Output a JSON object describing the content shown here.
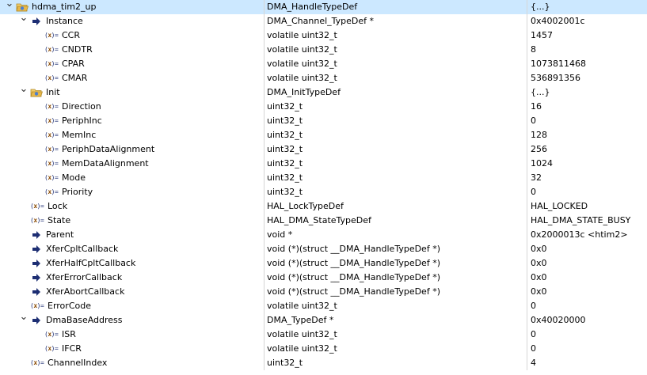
{
  "rows": [
    {
      "id": "r0",
      "name": "hdma_tim2_up",
      "type": "DMA_HandleTypeDef",
      "value": "{...}",
      "icon": "struct-open-folder-icon",
      "depth": 0,
      "toggle": "expanded",
      "selected": true
    },
    {
      "id": "r1",
      "name": "Instance",
      "type": "DMA_Channel_TypeDef *",
      "value": "0x4002001c",
      "icon": "pointer-arrow-icon",
      "depth": 1,
      "toggle": "expanded"
    },
    {
      "id": "r2",
      "name": "CCR",
      "type": "volatile uint32_t",
      "value": "1457",
      "icon": "variable-icon",
      "depth": 2
    },
    {
      "id": "r3",
      "name": "CNDTR",
      "type": "volatile uint32_t",
      "value": "8",
      "icon": "variable-icon",
      "depth": 2
    },
    {
      "id": "r4",
      "name": "CPAR",
      "type": "volatile uint32_t",
      "value": "1073811468",
      "icon": "variable-icon",
      "depth": 2
    },
    {
      "id": "r5",
      "name": "CMAR",
      "type": "volatile uint32_t",
      "value": "536891356",
      "icon": "variable-icon",
      "depth": 2
    },
    {
      "id": "r6",
      "name": "Init",
      "type": "DMA_InitTypeDef",
      "value": "{...}",
      "icon": "struct-open-folder-icon",
      "depth": 1,
      "toggle": "expanded"
    },
    {
      "id": "r7",
      "name": "Direction",
      "type": "uint32_t",
      "value": "16",
      "icon": "variable-icon",
      "depth": 2
    },
    {
      "id": "r8",
      "name": "PeriphInc",
      "type": "uint32_t",
      "value": "0",
      "icon": "variable-icon",
      "depth": 2
    },
    {
      "id": "r9",
      "name": "MemInc",
      "type": "uint32_t",
      "value": "128",
      "icon": "variable-icon",
      "depth": 2
    },
    {
      "id": "r10",
      "name": "PeriphDataAlignment",
      "type": "uint32_t",
      "value": "256",
      "icon": "variable-icon",
      "depth": 2
    },
    {
      "id": "r11",
      "name": "MemDataAlignment",
      "type": "uint32_t",
      "value": "1024",
      "icon": "variable-icon",
      "depth": 2
    },
    {
      "id": "r12",
      "name": "Mode",
      "type": "uint32_t",
      "value": "32",
      "icon": "variable-icon",
      "depth": 2
    },
    {
      "id": "r13",
      "name": "Priority",
      "type": "uint32_t",
      "value": "0",
      "icon": "variable-icon",
      "depth": 2
    },
    {
      "id": "r14",
      "name": "Lock",
      "type": "HAL_LockTypeDef",
      "value": "HAL_LOCKED",
      "icon": "variable-icon",
      "depth": 1
    },
    {
      "id": "r15",
      "name": "State",
      "type": "HAL_DMA_StateTypeDef",
      "value": "HAL_DMA_STATE_BUSY",
      "icon": "variable-icon",
      "depth": 1
    },
    {
      "id": "r16",
      "name": "Parent",
      "type": "void *",
      "value": "0x2000013c <htim2>",
      "icon": "pointer-arrow-icon",
      "depth": 1
    },
    {
      "id": "r17",
      "name": "XferCpltCallback",
      "type": "void (*)(struct __DMA_HandleTypeDef *)",
      "value": "0x0",
      "icon": "pointer-arrow-icon",
      "depth": 1
    },
    {
      "id": "r18",
      "name": "XferHalfCpltCallback",
      "type": "void (*)(struct __DMA_HandleTypeDef *)",
      "value": "0x0",
      "icon": "pointer-arrow-icon",
      "depth": 1
    },
    {
      "id": "r19",
      "name": "XferErrorCallback",
      "type": "void (*)(struct __DMA_HandleTypeDef *)",
      "value": "0x0",
      "icon": "pointer-arrow-icon",
      "depth": 1
    },
    {
      "id": "r20",
      "name": "XferAbortCallback",
      "type": "void (*)(struct __DMA_HandleTypeDef *)",
      "value": "0x0",
      "icon": "pointer-arrow-icon",
      "depth": 1
    },
    {
      "id": "r21",
      "name": "ErrorCode",
      "type": "volatile uint32_t",
      "value": "0",
      "icon": "variable-icon",
      "depth": 1
    },
    {
      "id": "r22",
      "name": "DmaBaseAddress",
      "type": "DMA_TypeDef *",
      "value": "0x40020000",
      "icon": "pointer-arrow-icon",
      "depth": 1,
      "toggle": "expanded"
    },
    {
      "id": "r23",
      "name": "ISR",
      "type": "volatile uint32_t",
      "value": "0",
      "icon": "variable-icon",
      "depth": 2
    },
    {
      "id": "r24",
      "name": "IFCR",
      "type": "volatile uint32_t",
      "value": "0",
      "icon": "variable-icon",
      "depth": 2
    },
    {
      "id": "r25",
      "name": "ChannelIndex",
      "type": "uint32_t",
      "value": "4",
      "icon": "variable-icon",
      "depth": 1
    }
  ],
  "colors": {
    "selection": "#cce8ff",
    "folder": "#e8b84a",
    "arrow": "#1d2e73",
    "separator": "#d6d6d6"
  }
}
